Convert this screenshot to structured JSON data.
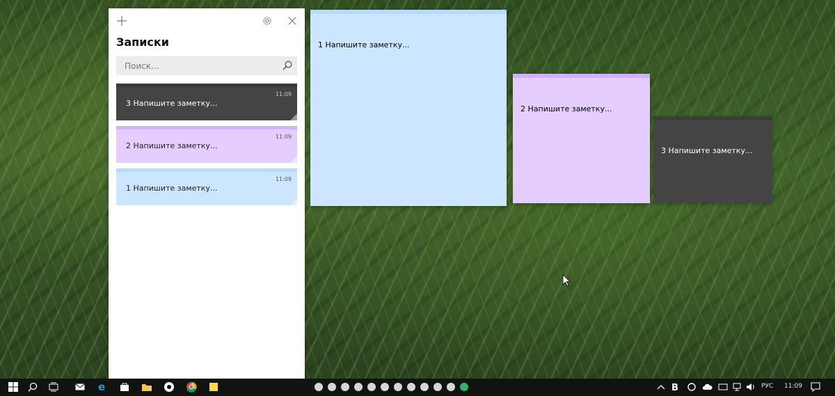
{
  "app": {
    "title": "Записки",
    "search_placeholder": "Поиск...",
    "add_icon": "plus-icon",
    "settings_icon": "gear-icon",
    "close_icon": "close-icon"
  },
  "list_notes": [
    {
      "time": "11:09",
      "text": "3 Напишите заметку...",
      "color": "#444444",
      "band": "#3a3a3a",
      "text_color": "#ffffff"
    },
    {
      "time": "11:09",
      "text": "2 Напишите заметку...",
      "color": "#e6cdff",
      "band": "#d6b2fb",
      "text_color": "#222222"
    },
    {
      "time": "11:09",
      "text": "1 Напишите заметку...",
      "color": "#cce6ff",
      "band": "#b8dbfd",
      "text_color": "#222222"
    }
  ],
  "sticky_notes": [
    {
      "text": "1 Напишите заметку...",
      "color": "#cce6ff",
      "band": "#b6dafd"
    },
    {
      "text": "2 Напишите заметку...",
      "color": "#e6cdff",
      "band": "#d4b0fa"
    },
    {
      "text": "3 Напишите заметку...",
      "color": "#444444",
      "band": "#3c3c3c"
    }
  ],
  "taskbar": {
    "language": "РУС",
    "clock": "11:09"
  }
}
